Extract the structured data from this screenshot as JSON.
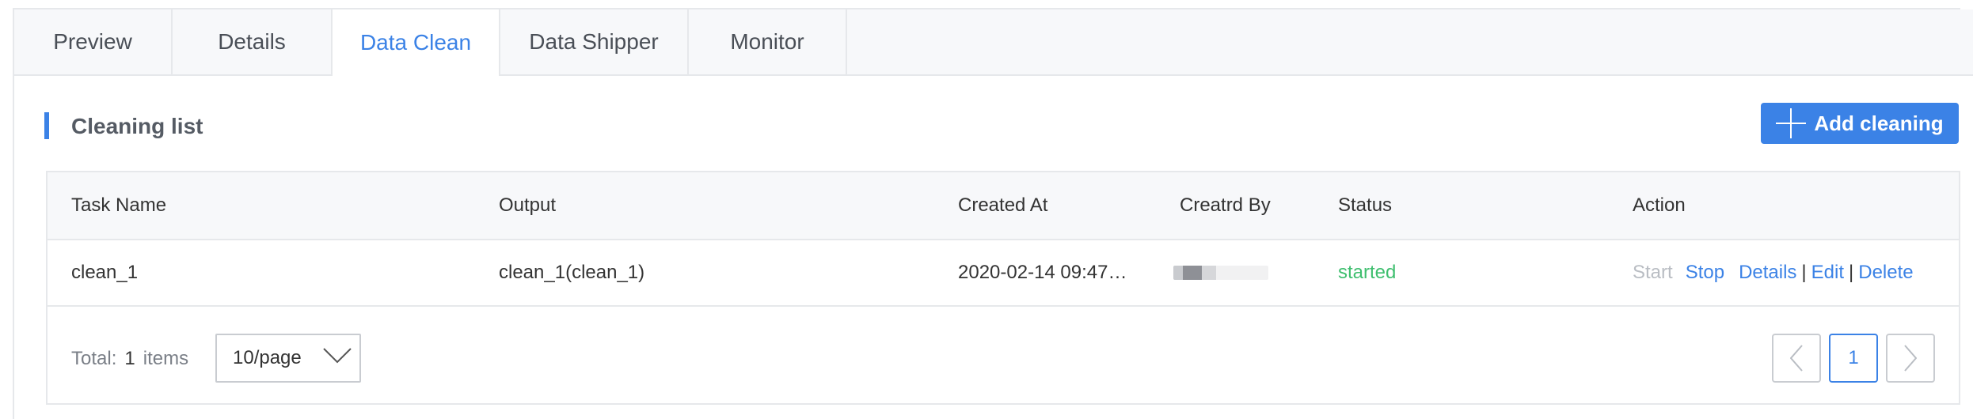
{
  "tabs": [
    {
      "label": "Preview",
      "active": false
    },
    {
      "label": "Details",
      "active": false
    },
    {
      "label": "Data Clean",
      "active": true
    },
    {
      "label": "Data Shipper",
      "active": false
    },
    {
      "label": "Monitor",
      "active": false
    }
  ],
  "section": {
    "title": "Cleaning list",
    "add_button": "Add cleaning"
  },
  "table": {
    "headers": {
      "task_name": "Task Name",
      "output": "Output",
      "created_at": "Created At",
      "created_by": "Creatrd By",
      "status": "Status",
      "action": "Action"
    },
    "rows": [
      {
        "task_name": "clean_1",
        "output": "clean_1(clean_1)",
        "created_at": "2020-02-14 09:47…",
        "created_by": "",
        "status": "started",
        "actions": {
          "start": "Start",
          "stop": "Stop",
          "details": "Details",
          "sep1": "|",
          "edit": "Edit",
          "sep2": "|",
          "delete": "Delete"
        }
      }
    ]
  },
  "footer": {
    "total_label": "Total:",
    "total_count": "1",
    "total_unit": "items",
    "page_size": "10/page",
    "current_page": "1"
  },
  "colors": {
    "accent": "#3b82e6",
    "status_started": "#3fbf6f",
    "disabled": "#b9bdc3"
  }
}
